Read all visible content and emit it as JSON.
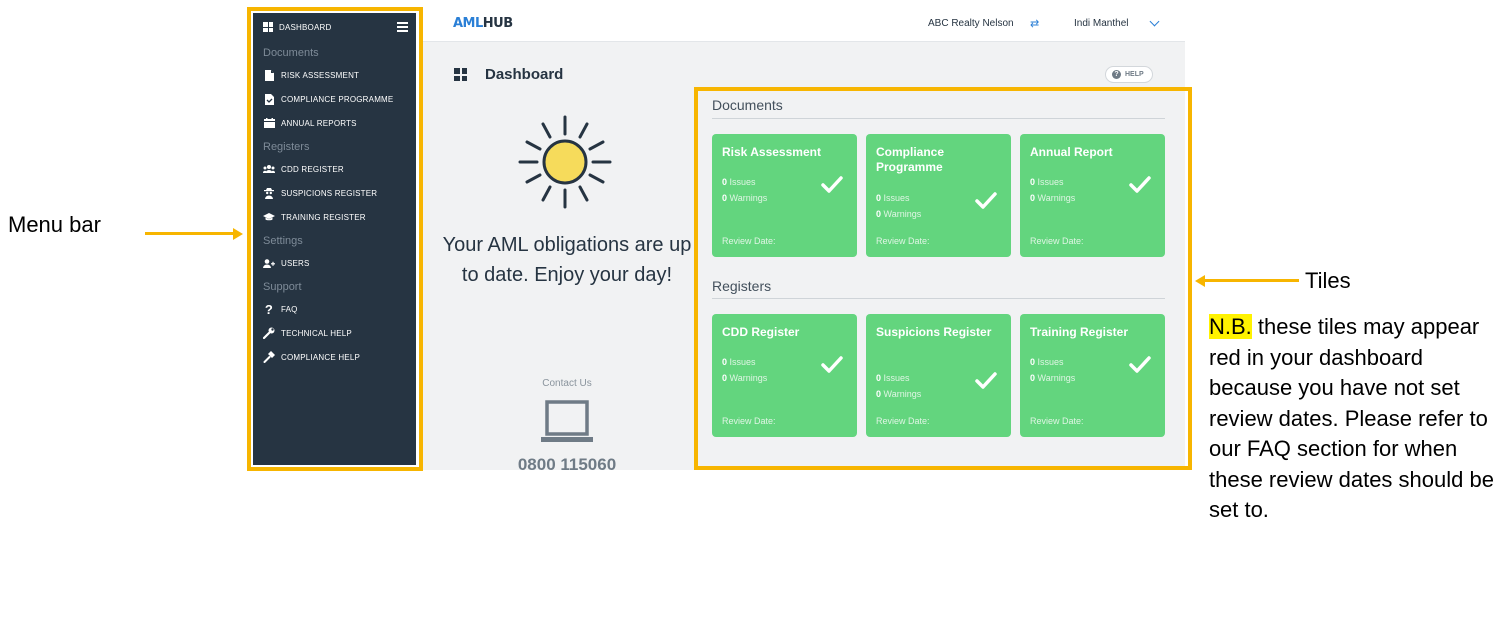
{
  "sidebar": {
    "dashboard_label": "DASHBOARD",
    "sections": {
      "documents": "Documents",
      "registers": "Registers",
      "settings": "Settings",
      "support": "Support"
    },
    "items": {
      "risk_assessment": "RISK ASSESSMENT",
      "compliance_programme": "COMPLIANCE PROGRAMME",
      "annual_reports": "ANNUAL REPORTS",
      "cdd_register": "CDD REGISTER",
      "suspicions_register": "SUSPICIONS REGISTER",
      "training_register": "TRAINING REGISTER",
      "users": "USERS",
      "faq": "FAQ",
      "technical_help": "TECHNICAL HELP",
      "compliance_help": "COMPLIANCE HELP"
    }
  },
  "header": {
    "logo_part1": "AML",
    "logo_part2": "HUB",
    "organisation": "ABC Realty Nelson",
    "user_name": "Indi Manthel"
  },
  "page": {
    "title": "Dashboard",
    "help_label": "HELP",
    "status_message": "Your AML obligations are up to date. Enjoy your day!",
    "contact_label": "Contact Us",
    "phone": "0800 115060"
  },
  "sections": {
    "documents": "Documents",
    "registers": "Registers"
  },
  "tiles": {
    "risk_assessment": {
      "title": "Risk Assessment",
      "issues": "0",
      "warnings": "0"
    },
    "compliance_programme": {
      "title": "Compliance Programme",
      "issues": "0",
      "warnings": "0"
    },
    "annual_report": {
      "title": "Annual Report",
      "issues": "0",
      "warnings": "0"
    },
    "cdd_register": {
      "title": "CDD Register",
      "issues": "0",
      "warnings": "0"
    },
    "suspicions_register": {
      "title": "Suspicions Register",
      "issues": "0",
      "warnings": "0"
    },
    "training_register": {
      "title": "Training Register",
      "issues": "0",
      "warnings": "0"
    }
  },
  "tile_labels": {
    "issues": "Issues",
    "warnings": "Warnings",
    "review_date": "Review Date:"
  },
  "annotations": {
    "menu_bar": "Menu bar",
    "tiles": "Tiles",
    "nb_highlight": "N.B.",
    "nb_text": " these tiles may appear red in your dashboard because you have not set review dates. Please refer to our FAQ section for when these review dates should be set to."
  },
  "colors": {
    "sidebar": "#263442",
    "tile_green": "#63d57e",
    "highlight": "#f7b500",
    "nb_highlight": "#fff200",
    "accent": "#2a7fd6"
  },
  "icons": {
    "dashboard": "grid-icon",
    "risk_assessment": "file-icon",
    "compliance_programme": "file-check-icon",
    "annual_reports": "calendar-icon",
    "cdd_register": "users-group-icon",
    "suspicions_register": "spy-icon",
    "training_register": "graduation-cap-icon",
    "users": "user-plus-icon",
    "faq": "question-icon",
    "technical_help": "wrench-icon",
    "compliance_help": "hammer-icon"
  }
}
